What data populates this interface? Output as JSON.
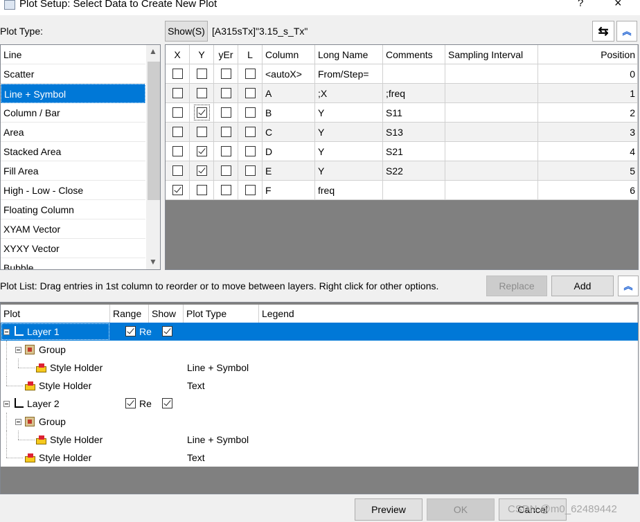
{
  "window": {
    "title": "Plot Setup: Select Data to Create New Plot",
    "help": "?",
    "close": "×"
  },
  "plot_type_label": "Plot Type:",
  "show_button": "Show(S)",
  "book_path": "[A315sTx]\"3.15_s_Tx\"",
  "swap_icon": "⇆",
  "chevron_icon": "︽",
  "plot_types": [
    "Line",
    "Scatter",
    "Line + Symbol",
    "Column / Bar",
    "Area",
    "Stacked Area",
    "Fill Area",
    "High - Low - Close",
    "Floating Column",
    "XYAM Vector",
    "XYXY Vector",
    "Bubble"
  ],
  "selected_plot_type": "Line + Symbol",
  "grid": {
    "headers": [
      "X",
      "Y",
      "yEr",
      "L",
      "Column",
      "Long Name",
      "Comments",
      "Sampling Interval",
      "Position"
    ],
    "rows": [
      {
        "x": false,
        "y": false,
        "yer": false,
        "l": false,
        "column": "<autoX>",
        "long_name": "From/Step=",
        "comments": "",
        "sampling": "",
        "position": "0"
      },
      {
        "x": false,
        "y": false,
        "yer": false,
        "l": false,
        "column": "A",
        "long_name": ";X",
        "comments": ";freq",
        "sampling": "",
        "position": "1"
      },
      {
        "x": false,
        "y": true,
        "yer": false,
        "l": false,
        "column": "B",
        "long_name": "Y",
        "comments": "S11",
        "sampling": "",
        "position": "2"
      },
      {
        "x": false,
        "y": false,
        "yer": false,
        "l": false,
        "column": "C",
        "long_name": "Y",
        "comments": "S13",
        "sampling": "",
        "position": "3"
      },
      {
        "x": false,
        "y": true,
        "yer": false,
        "l": false,
        "column": "D",
        "long_name": "Y",
        "comments": "S21",
        "sampling": "",
        "position": "4"
      },
      {
        "x": false,
        "y": true,
        "yer": false,
        "l": false,
        "column": "E",
        "long_name": "Y",
        "comments": "S22",
        "sampling": "",
        "position": "5"
      },
      {
        "x": true,
        "y": false,
        "yer": false,
        "l": false,
        "column": "F",
        "long_name": "freq",
        "comments": "",
        "sampling": "",
        "position": "6"
      }
    ]
  },
  "plot_list_hint": "Plot List: Drag entries in 1st column to reorder or to move between layers. Right click for other options.",
  "replace_button": "Replace",
  "add_button": "Add",
  "tree": {
    "headers": [
      "Plot",
      "Range",
      "Show",
      "Plot Type",
      "Legend"
    ],
    "layer1": "Layer 1",
    "layer2": "Layer 2",
    "range_short": "Re",
    "group": "Group",
    "style_holder": "Style Holder",
    "line_symbol": "Line + Symbol",
    "text": "Text"
  },
  "buttons": {
    "preview": "Preview",
    "ok": "OK",
    "cancel": "Cancel"
  },
  "watermark": "CSDN @m0_62489442"
}
